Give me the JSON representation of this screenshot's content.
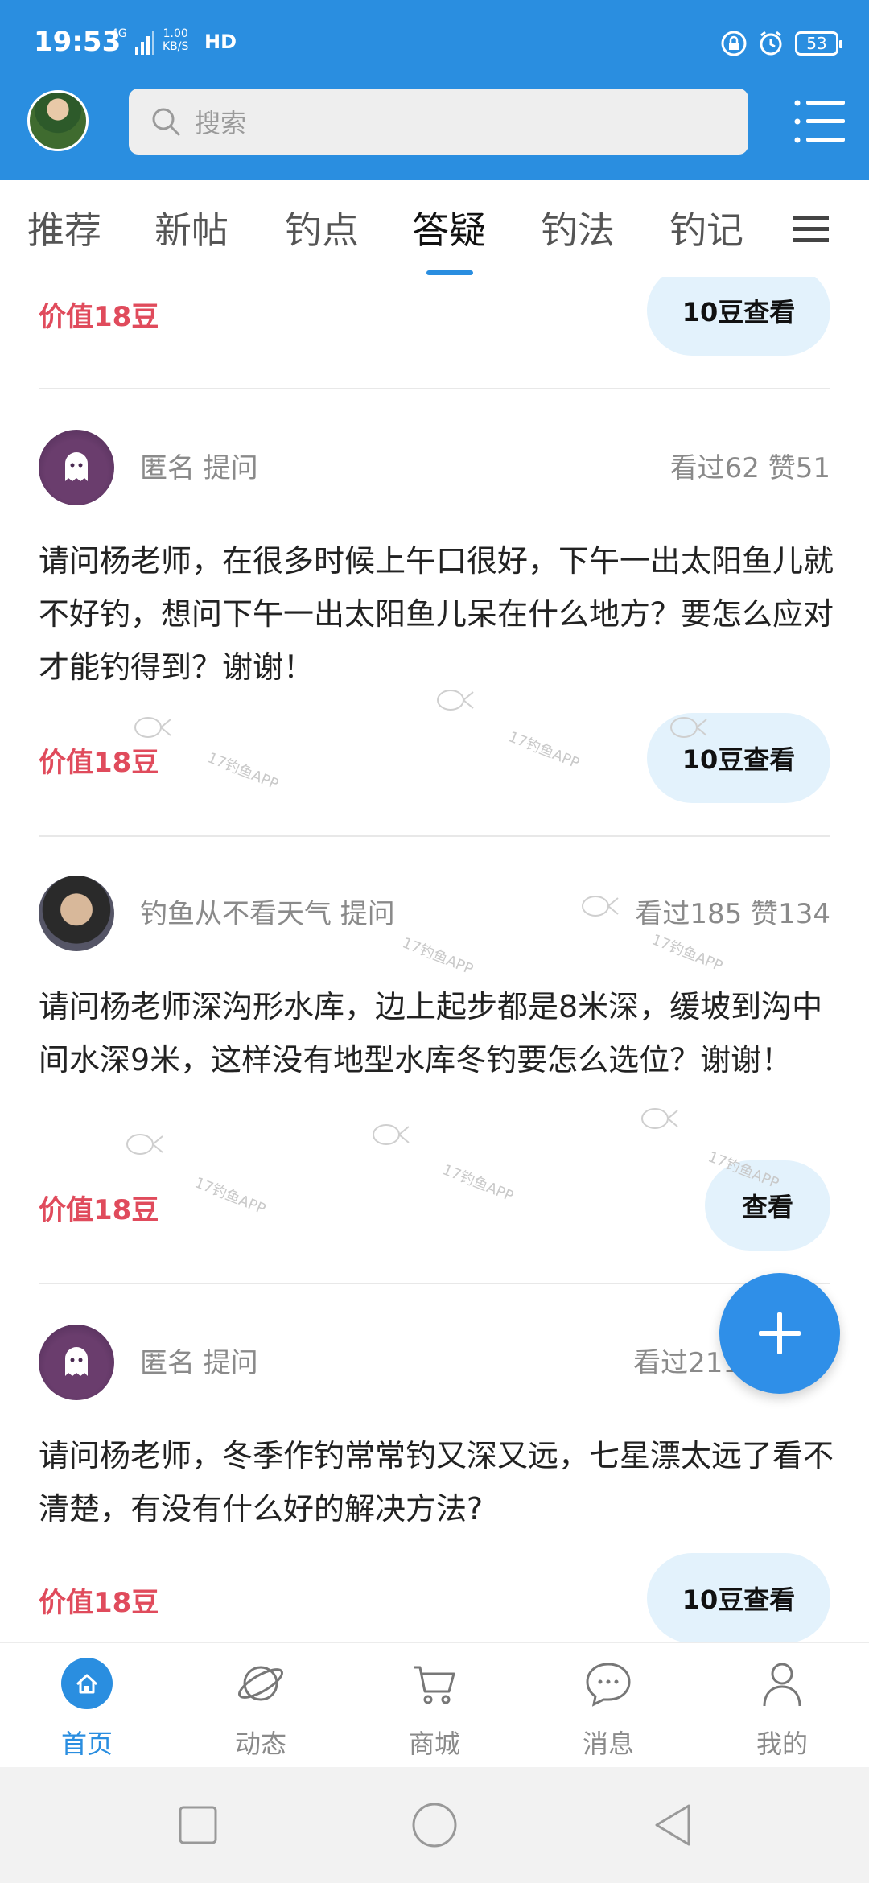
{
  "status_bar": {
    "time": "19:53",
    "network": "4G",
    "speed_value": "1.00",
    "speed_unit": "KB/S",
    "hd": "HD",
    "battery": "53"
  },
  "header": {
    "search_placeholder": "搜索"
  },
  "tabs": [
    "推荐",
    "新帖",
    "钓点",
    "答疑",
    "钓法",
    "钓记"
  ],
  "active_tab": "答疑",
  "posts": [
    {
      "value": "价值18豆",
      "button": "10豆查看"
    },
    {
      "author": "匿名 提问",
      "stats": "看过62   赞51",
      "text": "请问杨老师，在很多时候上午口很好，下午一出太阳鱼儿就不好钓，想问下午一出太阳鱼儿呆在什么地方？要怎么应对才能钓得到？谢谢！",
      "value": "价值18豆",
      "button": "10豆查看"
    },
    {
      "author": "钓鱼从不看天气 提问",
      "stats": "看过185   赞134",
      "text": "请问杨老师深沟形水库，边上起步都是8米深，缓坡到沟中间水深9米，这样没有地型水库冬钓要怎么选位？谢谢！",
      "value": "价值18豆",
      "button": "查看"
    },
    {
      "author": "匿名 提问",
      "stats": "看过211",
      "text": "请问杨老师，冬季作钓常常钓又深又远，七星漂太远了看不清楚，有没有什么好的解决方法?",
      "value": "价值18豆",
      "button": "10豆查看"
    }
  ],
  "watermark_text": "17钓鱼APP",
  "bottom_nav": [
    {
      "label": "首页",
      "icon": "home-icon",
      "active": true
    },
    {
      "label": "动态",
      "icon": "planet-icon",
      "active": false
    },
    {
      "label": "商城",
      "icon": "cart-icon",
      "active": false
    },
    {
      "label": "消息",
      "icon": "chat-icon",
      "active": false
    },
    {
      "label": "我的",
      "icon": "user-icon",
      "active": false
    }
  ],
  "colors": {
    "primary": "#2a8ee0",
    "value_red": "#e04b5c",
    "button_bg": "#e3f2fc"
  }
}
